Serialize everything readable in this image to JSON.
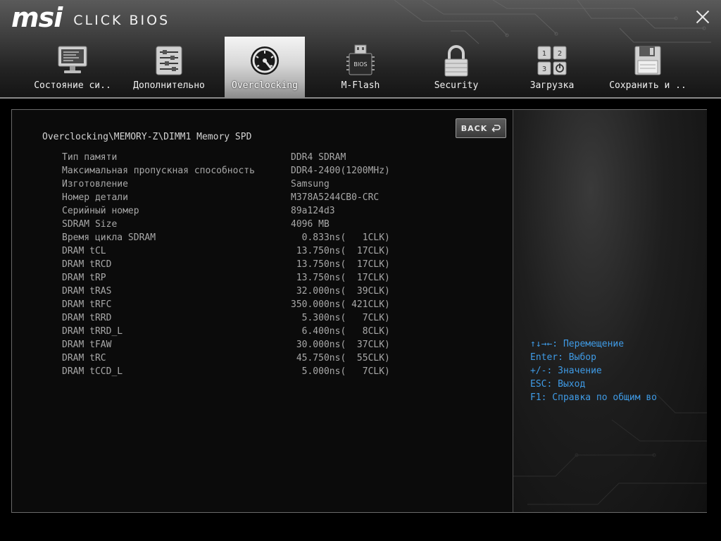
{
  "header": {
    "brand": "msi",
    "product": "CLICK BIOS",
    "tabs": [
      {
        "label": "Состояние си..",
        "icon": "monitor-icon"
      },
      {
        "label": "Дополнительно",
        "icon": "settings-sliders-icon"
      },
      {
        "label": "Overclocking",
        "icon": "speedometer-icon",
        "active": true
      },
      {
        "label": "M-Flash",
        "icon": "bios-usb-icon"
      },
      {
        "label": "Security",
        "icon": "padlock-icon"
      },
      {
        "label": "Загрузка",
        "icon": "boot-keys-icon"
      },
      {
        "label": "Сохранить и ..",
        "icon": "floppy-disk-icon"
      }
    ]
  },
  "page": {
    "breadcrumb": "Overclocking\\MEMORY-Z\\DIMM1 Memory SPD",
    "back_label": "BACK"
  },
  "spd": [
    {
      "label": "Тип памяти",
      "value": "DDR4 SDRAM"
    },
    {
      "label": "Максимальная пропускная способность",
      "value": "DDR4-2400(1200MHz)"
    },
    {
      "label": "Изготовление",
      "value": "Samsung"
    },
    {
      "label": "Номер детали",
      "value": "M378A5244CB0-CRC"
    },
    {
      "label": "Серийный номер",
      "value": "89a124d3"
    },
    {
      "label": "SDRAM Size",
      "value": "4096 MB"
    },
    {
      "label": "Время цикла SDRAM",
      "value": "  0.833ns(   1CLK)"
    },
    {
      "label": "DRAM tCL",
      "value": " 13.750ns(  17CLK)"
    },
    {
      "label": "DRAM tRCD",
      "value": " 13.750ns(  17CLK)"
    },
    {
      "label": "DRAM tRP",
      "value": " 13.750ns(  17CLK)"
    },
    {
      "label": "DRAM tRAS",
      "value": " 32.000ns(  39CLK)"
    },
    {
      "label": "DRAM tRFC",
      "value": "350.000ns( 421CLK)"
    },
    {
      "label": "DRAM tRRD",
      "value": "  5.300ns(   7CLK)"
    },
    {
      "label": "DRAM tRRD_L",
      "value": "  6.400ns(   8CLK)"
    },
    {
      "label": "DRAM tFAW",
      "value": " 30.000ns(  37CLK)"
    },
    {
      "label": "DRAM tRC",
      "value": " 45.750ns(  55CLK)"
    },
    {
      "label": "DRAM tCCD_L",
      "value": "  5.000ns(   7CLK)"
    }
  ],
  "help": [
    "↑↓→←: Перемещение",
    "Enter: Выбор",
    "+/-: Значение",
    "ESC: Выход",
    "F1: Справка по общим во"
  ],
  "colors": {
    "help_text": "#3f9be6",
    "active_tab": "#d8d8d8"
  }
}
